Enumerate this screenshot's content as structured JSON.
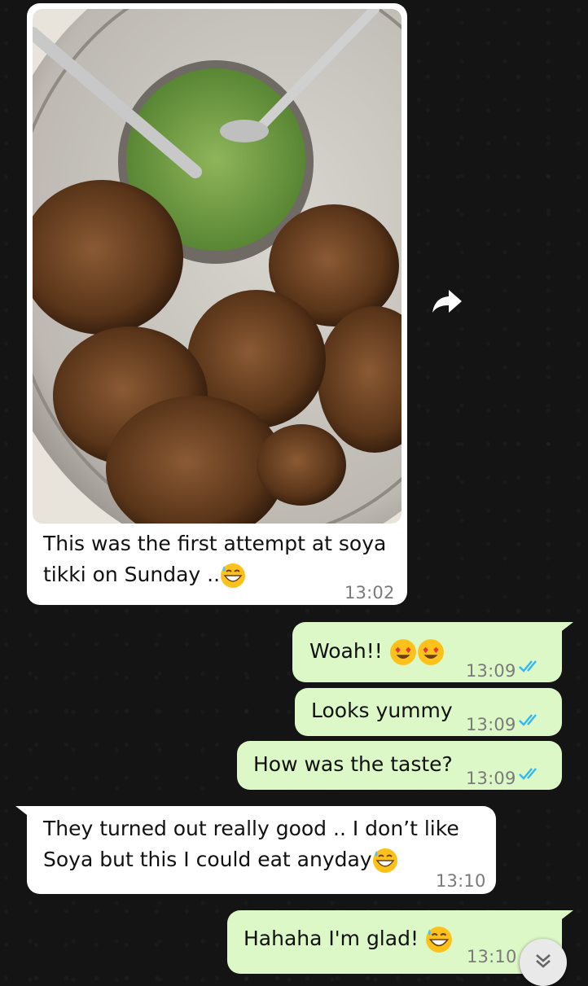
{
  "messages": [
    {
      "id": "m1",
      "direction": "incoming",
      "has_photo": true,
      "text": "This was the first attempt at soya tikki on Sunday ..",
      "emoji": "grinning-sweat",
      "time": "13:02"
    },
    {
      "id": "m2",
      "direction": "outgoing",
      "text": "Woah!!",
      "emoji": "heart-eyes x2",
      "time": "13:09",
      "status": "read"
    },
    {
      "id": "m3",
      "direction": "outgoing",
      "text": "Looks yummy",
      "time": "13:09",
      "status": "read"
    },
    {
      "id": "m4",
      "direction": "outgoing",
      "text": "How was the taste?",
      "time": "13:09",
      "status": "read"
    },
    {
      "id": "m5",
      "direction": "incoming",
      "text": "They turned out really good .. I don’t like Soya but this I could eat anyday",
      "emoji": "grinning-sweat",
      "time": "13:10"
    },
    {
      "id": "m6",
      "direction": "outgoing",
      "text": "Hahaha I'm glad!",
      "emoji": "grinning-sweat",
      "time": "13:10",
      "status": "read"
    }
  ],
  "m1_lines": [
    "This was the first attempt at soya",
    "tikki on Sunday .."
  ],
  "m5_lines": [
    "They turned out really good .. I don’t like",
    "Soya but this I could eat anyday"
  ],
  "colors": {
    "incoming": "#ffffff",
    "outgoing": "#dcf8c6",
    "read_ticks": "#34b7f1",
    "background": "#141414"
  },
  "icons": [
    "forward-icon",
    "double-check-icon",
    "scroll-down-icon"
  ]
}
